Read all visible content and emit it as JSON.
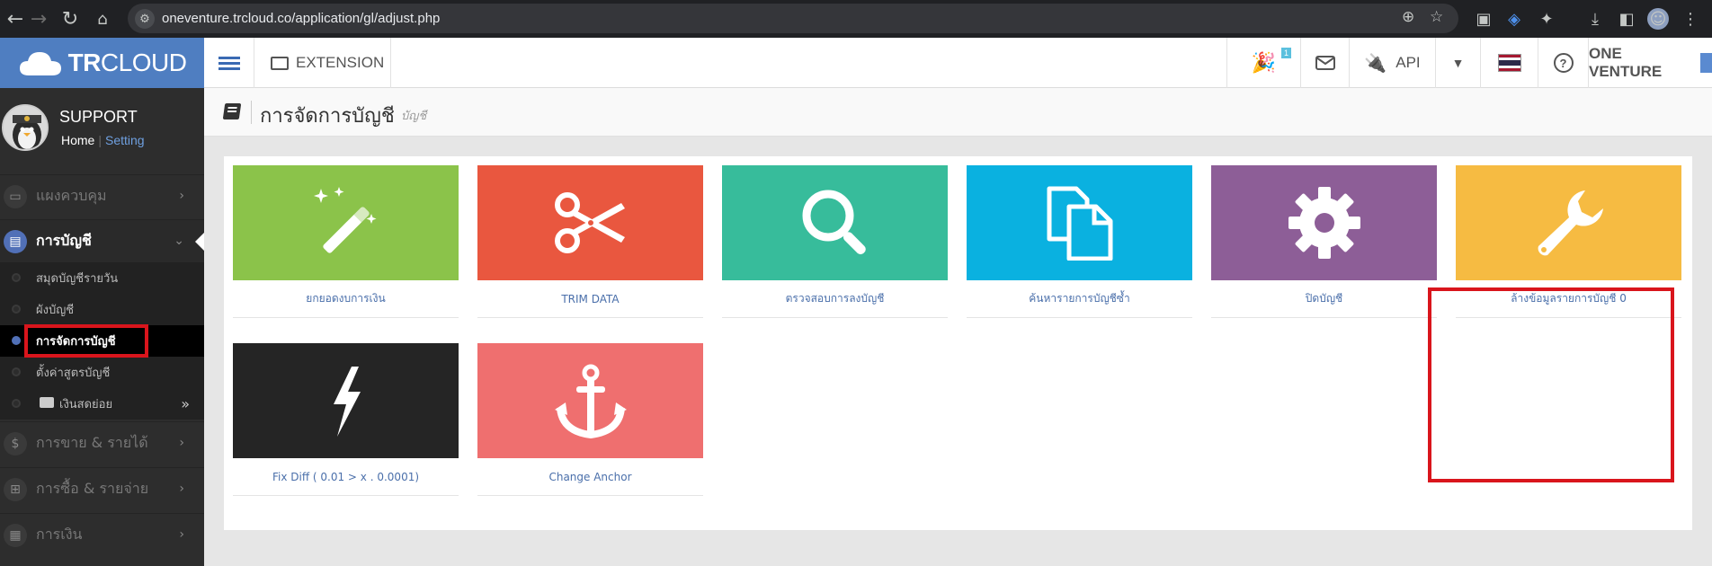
{
  "browser": {
    "url": "oneventure.trcloud.co/application/gl/adjust.php"
  },
  "header": {
    "brand_bold": "TR",
    "brand_rest": "CLOUD",
    "extension_label": "EXTENSION",
    "notification_count": "1",
    "api_label": "API",
    "company": "ONE VENTURE"
  },
  "sidebar": {
    "user_name": "SUPPORT",
    "home_link": "Home",
    "setting_link": "Setting",
    "menu": [
      {
        "label": "แผงควบคุม"
      },
      {
        "label": "การบัญชี"
      },
      {
        "label": "การขาย & รายได้"
      },
      {
        "label": "การซื้อ & รายจ่าย"
      },
      {
        "label": "การเงิน"
      }
    ],
    "submenu": [
      {
        "label": "สมุดบัญชีรายวัน"
      },
      {
        "label": "ผังบัญชี"
      },
      {
        "label": "การจัดการบัญชี"
      },
      {
        "label": "ตั้งค่าสูตรบัญชี"
      },
      {
        "label": "เงินสดย่อย"
      }
    ]
  },
  "page": {
    "title": "การจัดการบัญชี",
    "subtitle": "บัญชี"
  },
  "tiles": [
    {
      "label": "ยกยอดงบการเงิน",
      "icon": "magic-wand-icon",
      "color": "#8bc34a"
    },
    {
      "label": "TRIM DATA",
      "icon": "scissors-icon",
      "color": "#e9573f"
    },
    {
      "label": "ตรวจสอบการลงบัญชี",
      "icon": "search-icon",
      "color": "#37bc9b"
    },
    {
      "label": "ค้นหารายการบัญชีซ้ำ",
      "icon": "copy-icon",
      "color": "#0ab1e0"
    },
    {
      "label": "ปิดบัญชี",
      "icon": "gear-icon",
      "color": "#8d5e97"
    },
    {
      "label": "ล้างข้อมูลรายการบัญชี 0",
      "icon": "wrench-icon",
      "color": "#f6bb42"
    },
    {
      "label": "Fix Diff ( 0.01 > x . 0.0001)",
      "icon": "lightning-icon",
      "color": "#252525"
    },
    {
      "label": "Change Anchor",
      "icon": "anchor-icon",
      "color": "#ef6f6f"
    }
  ]
}
